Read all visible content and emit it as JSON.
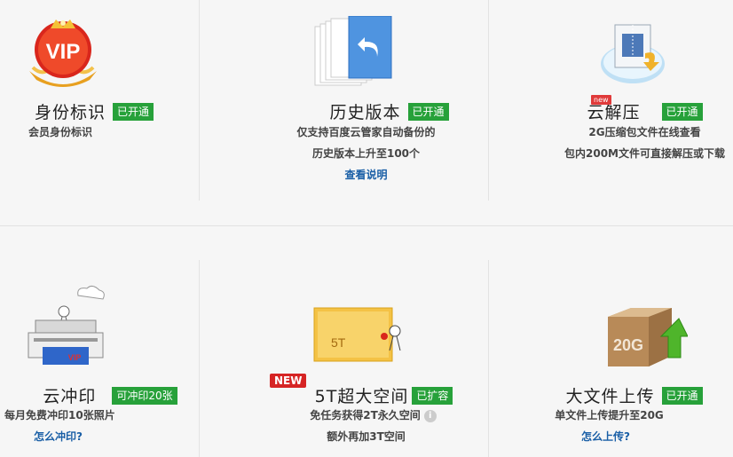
{
  "features": {
    "vip": {
      "title": "身份标识",
      "badge": "已开通",
      "desc": "会员身份标识",
      "icon_text": "VIP"
    },
    "history": {
      "title": "历史版本",
      "badge": "已开通",
      "desc1": "仅支持百度云管家自动备份的",
      "desc2": "历史版本上升至100个",
      "link": "查看说明"
    },
    "unzip": {
      "new_tag": "new",
      "title": "云解压",
      "badge": "已开通",
      "desc1": "2G压缩包文件在线查看",
      "desc2": "包内200M文件可直接解压或下载"
    },
    "print": {
      "title": "云冲印",
      "badge": "可冲印20张",
      "desc": "每月免费冲印10张照片",
      "link": "怎么冲印?",
      "icon_text": "VIP"
    },
    "space": {
      "new_tag": "NEW",
      "title": "5T超大空间",
      "badge": "已扩容",
      "desc1": "免任务获得2T永久空间",
      "info_icon": "i",
      "desc2": "额外再加3T空间",
      "icon_text": "5T"
    },
    "upload": {
      "title": "大文件上传",
      "badge": "已开通",
      "desc": "单文件上传提升至20G",
      "link": "怎么上传?",
      "icon_text": "20G"
    }
  },
  "colors": {
    "badge_green": "#27a13a",
    "link_blue": "#1a5fa6",
    "new_red": "#d62424"
  }
}
